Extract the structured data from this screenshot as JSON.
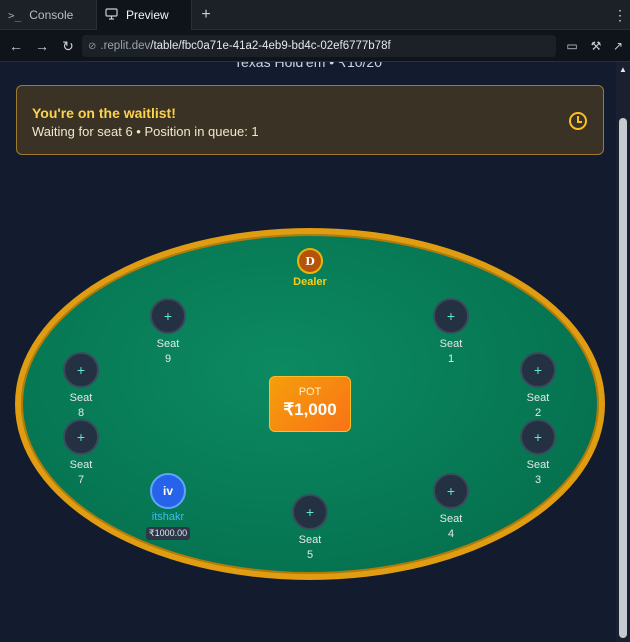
{
  "browser": {
    "tabs": [
      {
        "label": "Console",
        "icon": "terminal-icon"
      },
      {
        "label": "Preview",
        "icon": "monitor-icon"
      }
    ],
    "url_domain": ".replit.dev",
    "url_path": "/table/fbc0a71e-41a2-4eb9-bd4c-02ef6777b78f"
  },
  "page": {
    "subtitle": "Texas Hold'em • ₹10/20"
  },
  "waitlist": {
    "title": "You're on the waitlist!",
    "status": "Waiting for seat 6 • Position in queue: 1"
  },
  "table": {
    "dealer": {
      "chip": "D",
      "label": "Dealer"
    },
    "pot": {
      "label": "POT",
      "amount": "₹1,000"
    },
    "seats": [
      {
        "label": "Seat",
        "number": "1"
      },
      {
        "label": "Seat",
        "number": "2"
      },
      {
        "label": "Seat",
        "number": "3"
      },
      {
        "label": "Seat",
        "number": "4"
      },
      {
        "label": "Seat",
        "number": "5"
      },
      {
        "label": "Seat",
        "number": "7"
      },
      {
        "label": "Seat",
        "number": "8"
      },
      {
        "label": "Seat",
        "number": "9"
      }
    ],
    "player": {
      "initials": "iv",
      "name": "itshakr",
      "stack": "₹1000.00"
    }
  },
  "colors": {
    "felt": "#077a55",
    "rail": "#e19d12",
    "accent": "#fbbf24"
  }
}
